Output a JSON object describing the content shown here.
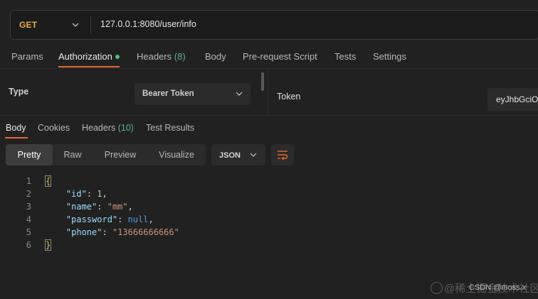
{
  "request": {
    "method": "GET",
    "method_color": "#e9b03c",
    "url": "127.0.0.1:8080/user/info"
  },
  "request_tabs": [
    {
      "label": "Params"
    },
    {
      "label": "Authorization"
    },
    {
      "label": "Headers",
      "count": "(8)"
    },
    {
      "label": "Body"
    },
    {
      "label": "Pre-request Script"
    },
    {
      "label": "Tests"
    },
    {
      "label": "Settings"
    }
  ],
  "auth": {
    "type_label": "Type",
    "type_value": "Bearer Token",
    "token_label": "Token",
    "token_value": "eyJhbGciO"
  },
  "response_tabs": [
    {
      "label": "Body"
    },
    {
      "label": "Cookies"
    },
    {
      "label": "Headers",
      "count": "(10)"
    },
    {
      "label": "Test Results"
    }
  ],
  "view_modes": [
    "Pretty",
    "Raw",
    "Preview",
    "Visualize"
  ],
  "format": "JSON",
  "code_lines": [
    "1",
    "2",
    "3",
    "4",
    "5",
    "6"
  ],
  "json_body": {
    "open_brace": "{",
    "close_brace": "}",
    "fields": [
      {
        "key": "\"id\"",
        "value": "1",
        "value_type": "number",
        "comma": ","
      },
      {
        "key": "\"name\"",
        "value": "\"mm\"",
        "value_type": "string",
        "comma": ","
      },
      {
        "key": "\"password\"",
        "value": "null",
        "value_type": "keyword",
        "comma": ","
      },
      {
        "key": "\"phone\"",
        "value": "\"13666666666\"",
        "value_type": "string",
        "comma": ""
      }
    ]
  },
  "watermark": {
    "text": "@稀土掘金技术社区",
    "csdn": "CSDN @moss.x"
  },
  "colors": {
    "accent": "#e9682e",
    "status_green": "#4cc07d",
    "background": "#212121"
  },
  "icons": [
    "chevron-down-icon",
    "status-dot-icon",
    "wrap-lines-icon"
  ]
}
